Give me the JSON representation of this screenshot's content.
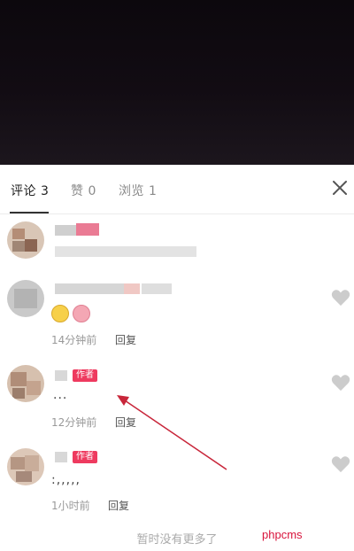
{
  "tabs": [
    {
      "label": "评论 3"
    },
    {
      "label": "赞 0"
    },
    {
      "label": "浏览 1"
    }
  ],
  "comments": [
    {
      "text": "",
      "time": "",
      "reply": ""
    },
    {
      "text": "",
      "time": "14分钟前",
      "reply": "回复"
    },
    {
      "text": "...",
      "time": "12分钟前",
      "reply": "回复",
      "badge": "作者"
    },
    {
      "text": ":,,,,,",
      "time": "1小时前",
      "reply": "回复",
      "badge": "作者"
    }
  ],
  "footer": {
    "text": "暂时没有更多了"
  },
  "watermark": {
    "text": "phpcms"
  },
  "icons": {
    "close": "close-icon",
    "like": "heart-icon"
  },
  "colors": {
    "accent": "#ee3a5f",
    "watermark": "#d8143c",
    "arrow": "#c8263a"
  }
}
